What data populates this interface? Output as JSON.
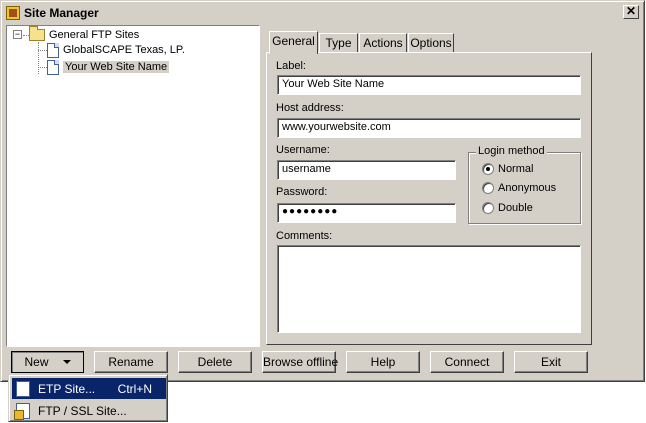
{
  "window": {
    "title": "Site Manager"
  },
  "tree": {
    "root": "General FTP Sites",
    "expander": "−",
    "items": [
      "GlobalSCAPE Texas, LP.",
      "Your Web Site Name"
    ]
  },
  "tabs": [
    "General",
    "Type",
    "Actions",
    "Options"
  ],
  "form": {
    "label_caption": "Label:",
    "label_value": "Your Web Site Name",
    "host_caption": "Host address:",
    "host_value": "www.yourwebsite.com",
    "username_caption": "Username:",
    "username_value": "username",
    "password_caption": "Password:",
    "password_value": "●●●●●●●●",
    "comments_caption": "Comments:",
    "comments_value": ""
  },
  "login_method": {
    "caption": "Login method",
    "options": [
      "Normal",
      "Anonymous",
      "Double"
    ],
    "selected": "Normal"
  },
  "buttons": {
    "new": "New",
    "rename": "Rename",
    "delete": "Delete",
    "browse_offline": "Browse offline",
    "help": "Help",
    "connect": "Connect",
    "exit": "Exit"
  },
  "new_menu": {
    "items": [
      {
        "label": "ETP Site...",
        "shortcut": "Ctrl+N",
        "icon": "page-icon"
      },
      {
        "label": "FTP / SSL Site...",
        "shortcut": "",
        "icon": "lock-page-icon"
      }
    ]
  },
  "colors": {
    "face": "#d4d0c8",
    "highlight": "#0a246a"
  }
}
